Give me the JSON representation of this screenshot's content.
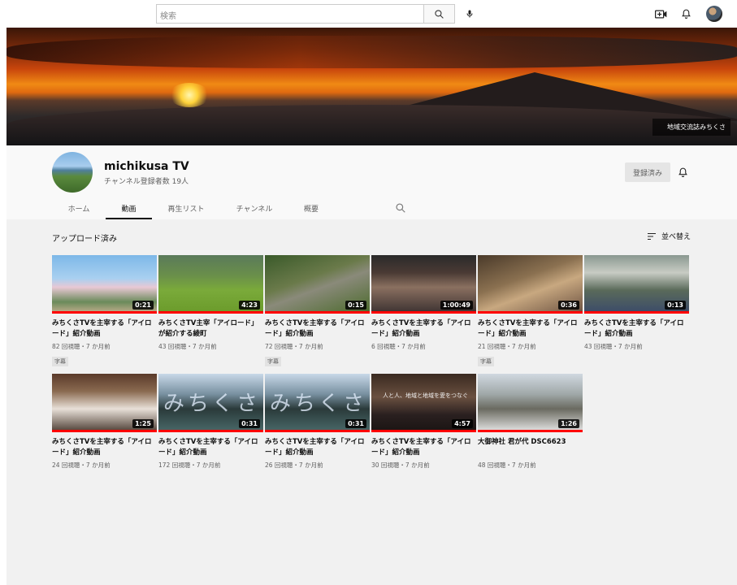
{
  "topbar": {
    "search_placeholder": "検索",
    "icons": [
      "search-icon",
      "mic-icon",
      "video-create-icon",
      "bell-icon",
      "avatar"
    ]
  },
  "banner": {
    "caption": "地域交流誌みちくさ"
  },
  "channel": {
    "name": "michikusa TV",
    "subscribers": "チャンネル登録者数 19人",
    "subscribed_label": "登録済み"
  },
  "tabs": [
    {
      "label": "ホーム"
    },
    {
      "label": "動画",
      "active": true
    },
    {
      "label": "再生リスト"
    },
    {
      "label": "チャンネル"
    },
    {
      "label": "概要"
    }
  ],
  "section": {
    "title": "アップロード済み",
    "sort_label": "並べ替え"
  },
  "videos": [
    {
      "title": "みちくさTVを主宰する「アイロード」紹介動画",
      "duration": "0:21",
      "meta": "82 回視聴・7 か月前",
      "badge": "字幕"
    },
    {
      "title": "みちくさTV主宰「アイロード」が紹介する綾町",
      "duration": "4:23",
      "meta": "43 回視聴・7 か月前",
      "badge": ""
    },
    {
      "title": "みちくさTVを主宰する「アイロード」紹介動画",
      "duration": "0:15",
      "meta": "72 回視聴・7 か月前",
      "badge": "字幕"
    },
    {
      "title": "みちくさTVを主宰する「アイロード」紹介動画",
      "duration": "1:00:49",
      "meta": "6 回視聴・7 か月前",
      "badge": ""
    },
    {
      "title": "みちくさTVを主宰する「アイロード」紹介動画",
      "duration": "0:36",
      "meta": "21 回視聴・7 か月前",
      "badge": "字幕"
    },
    {
      "title": "みちくさTVを主宰する「アイロード」紹介動画",
      "duration": "0:13",
      "meta": "43 回視聴・7 か月前",
      "badge": ""
    },
    {
      "title": "みちくさTVを主宰する「アイロード」紹介動画",
      "duration": "1:25",
      "meta": "24 回視聴・7 か月前",
      "badge": ""
    },
    {
      "title": "みちくさTVを主宰する「アイロード」紹介動画",
      "duration": "0:31",
      "meta": "172 回視聴・7 か月前",
      "badge": "",
      "overlay": "みちくさ"
    },
    {
      "title": "みちくさTVを主宰する「アイロード」紹介動画",
      "duration": "0:31",
      "meta": "26 回視聴・7 か月前",
      "badge": "",
      "overlay": "みちくさ"
    },
    {
      "title": "みちくさTVを主宰する「アイロード」紹介動画",
      "duration": "4:57",
      "meta": "30 回視聴・7 か月前",
      "badge": "",
      "overlay_small": "人と人、地域と地域を愛をつなぐ"
    },
    {
      "title": "大御神社 君が代 DSC6623",
      "duration": "1:26",
      "meta": "48 回視聴・7 か月前",
      "badge": ""
    }
  ]
}
